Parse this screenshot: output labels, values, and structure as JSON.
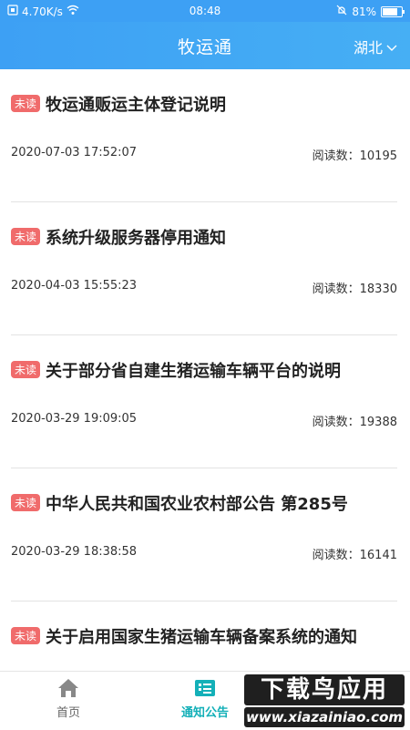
{
  "status_bar": {
    "speed": "4.70K/s",
    "time": "08:48",
    "battery": "81%"
  },
  "header": {
    "title": "牧运通",
    "region": "湖北"
  },
  "badge_label": "未读",
  "read_count_label": "阅读数：",
  "notices": [
    {
      "title": "牧运通贩运主体登记说明",
      "date": "2020-07-03 17:52:07",
      "reads": "10195"
    },
    {
      "title": "系统升级服务器停用通知",
      "date": "2020-04-03 15:55:23",
      "reads": "18330"
    },
    {
      "title": "关于部分省自建生猪运输车辆平台的说明",
      "date": "2020-03-29 19:09:05",
      "reads": "19388"
    },
    {
      "title": "中华人民共和国农业农村部公告 第285号",
      "date": "2020-03-29 18:38:58",
      "reads": "16141"
    },
    {
      "title": "关于启用国家生猪运输车辆备案系统的通知",
      "date": "",
      "reads": ""
    }
  ],
  "nav": {
    "home": "首页",
    "notice": "通知公告"
  },
  "watermark": {
    "line1": "下载鸟应用",
    "line2": "www.xiazainiao.com"
  },
  "colors": {
    "header": "#3da0f4",
    "badge": "#f06b6b",
    "active_nav": "#14b0b8"
  }
}
